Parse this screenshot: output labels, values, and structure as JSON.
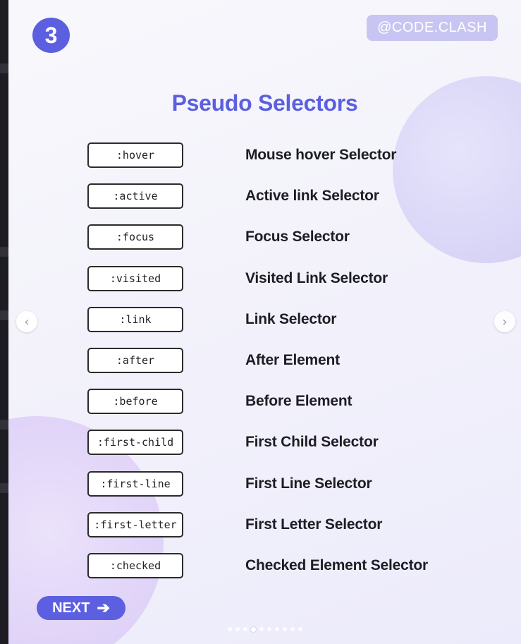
{
  "slide_number": "3",
  "handle": "@CODE.CLASH",
  "title": "Pseudo Selectors",
  "rows": [
    {
      "selector": ":hover",
      "description": "Mouse hover Selector"
    },
    {
      "selector": ":active",
      "description": "Active link Selector"
    },
    {
      "selector": ":focus",
      "description": "Focus Selector"
    },
    {
      "selector": ":visited",
      "description": "Visited Link Selector"
    },
    {
      "selector": ":link",
      "description": "Link Selector"
    },
    {
      "selector": ":after",
      "description": "After Element"
    },
    {
      "selector": ":before",
      "description": "Before Element"
    },
    {
      "selector": ":first-child",
      "description": "First Child Selector"
    },
    {
      "selector": ":first-line",
      "description": "First Line Selector"
    },
    {
      "selector": ":first-letter",
      "description": "First Letter Selector"
    },
    {
      "selector": ":checked",
      "description": "Checked Element Selector"
    }
  ],
  "next_label": "NEXT",
  "nav": {
    "prev_icon": "chevron-left-icon",
    "next_icon": "chevron-right-icon"
  },
  "pagination": {
    "total": 10,
    "active": 4
  },
  "colors": {
    "accent": "#5b5fe0",
    "handle_bg": "#c9c5f3",
    "text": "#1d1d24"
  }
}
